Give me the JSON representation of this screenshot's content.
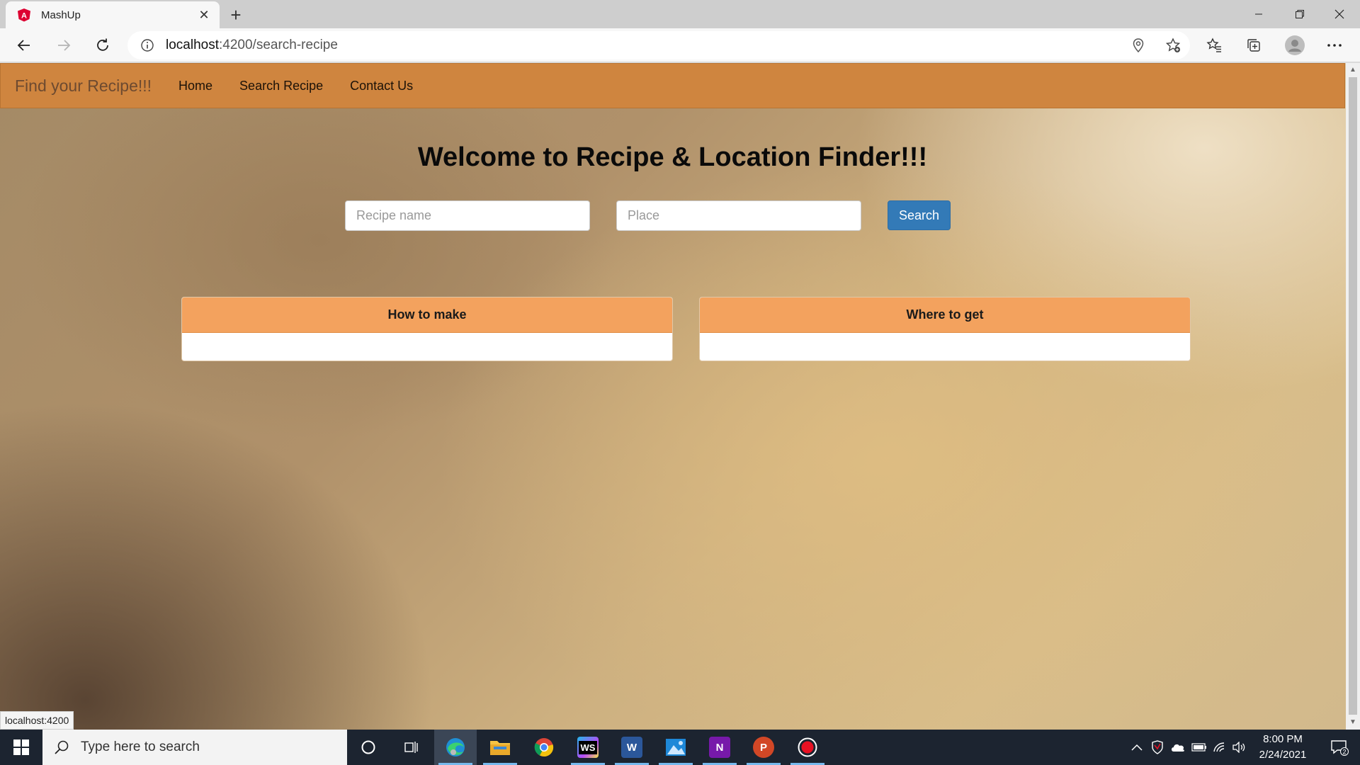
{
  "browser": {
    "tab_title": "MashUp",
    "tab_close": "✕",
    "new_tab": "+",
    "url_host": "localhost",
    "url_path": ":4200/search-recipe"
  },
  "app": {
    "brand": "Find your Recipe!!!",
    "nav": [
      "Home",
      "Search Recipe",
      "Contact Us"
    ],
    "heading": "Welcome to Recipe & Location Finder!!!",
    "recipe_placeholder": "Recipe name",
    "place_placeholder": "Place",
    "search_label": "Search",
    "panels": [
      "How to make",
      "Where to get"
    ],
    "accent": "#cf853f",
    "panel_header_color": "#f3a25e",
    "button_color": "#337ab7"
  },
  "status_bar": {
    "url": "localhost:4200"
  },
  "taskbar": {
    "search_placeholder": "Type here to search",
    "time": "8:00 PM",
    "date": "2/24/2021",
    "notification_count": "2",
    "apps": [
      "cortana-icon",
      "task-view-icon",
      "edge-icon",
      "file-explorer-icon",
      "chrome-icon",
      "webstorm-icon",
      "word-icon",
      "photos-icon",
      "onenote-icon",
      "powerpoint-icon",
      "recorder-icon"
    ]
  }
}
